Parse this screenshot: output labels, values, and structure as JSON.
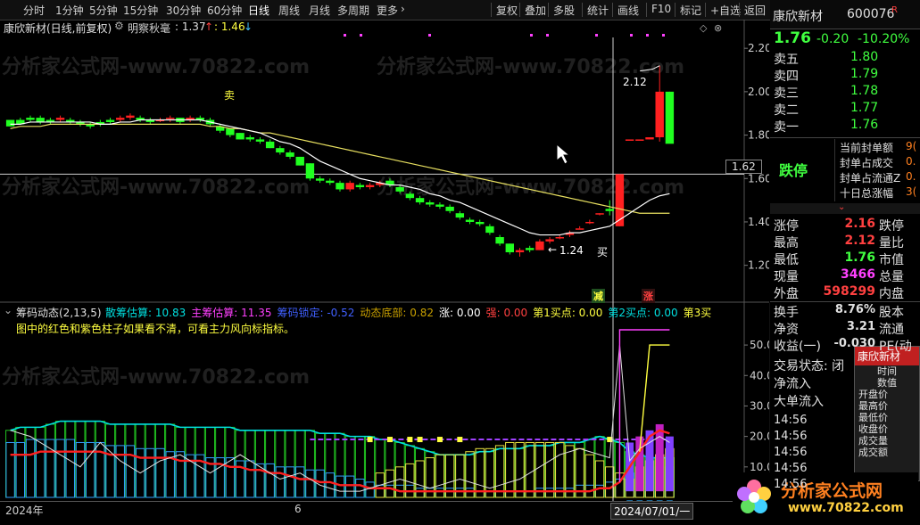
{
  "toolbar": {
    "periods": [
      "分时",
      "1分钟",
      "5分钟",
      "15分钟",
      "30分钟",
      "60分钟",
      "日线",
      "周线",
      "月线",
      "多周期",
      "更多"
    ],
    "active_period": "日线",
    "tools": [
      "复权",
      "叠加",
      "多股",
      "统计",
      "画线",
      "F10",
      "标记",
      "+自选",
      "返回"
    ]
  },
  "main_chart": {
    "title": "康欣新材(日线,前复权)",
    "indicator_name": "明察秋毫",
    "indicator_v1": ": 1.37",
    "indicator_v2": ": 1.46",
    "sell_label": "卖",
    "buy_label": "买",
    "high_annot": "2.12",
    "low_annot": "1.24",
    "cursor_price": "1.62",
    "y_ticks": [
      "2.20",
      "2.00",
      "1.80",
      "1.60",
      "1.40",
      "1.20"
    ],
    "badge_left": "减",
    "badge_right": "涨"
  },
  "chart_data": [
    {
      "type": "candlestick",
      "title": "康欣新材(日线,前复权)",
      "ylim": [
        1.1,
        2.25
      ],
      "ohlc": [
        [
          1.87,
          1.87,
          1.84,
          1.84
        ],
        [
          1.87,
          1.88,
          1.85,
          1.85
        ],
        [
          1.88,
          1.89,
          1.86,
          1.87
        ],
        [
          1.88,
          1.89,
          1.85,
          1.86
        ],
        [
          1.87,
          1.88,
          1.85,
          1.86
        ],
        [
          1.87,
          1.89,
          1.86,
          1.88
        ],
        [
          1.87,
          1.88,
          1.85,
          1.86
        ],
        [
          1.86,
          1.87,
          1.84,
          1.85
        ],
        [
          1.85,
          1.86,
          1.83,
          1.84
        ],
        [
          1.86,
          1.87,
          1.84,
          1.85
        ],
        [
          1.87,
          1.88,
          1.85,
          1.86
        ],
        [
          1.87,
          1.89,
          1.86,
          1.88
        ],
        [
          1.88,
          1.9,
          1.87,
          1.89
        ],
        [
          1.88,
          1.89,
          1.86,
          1.87
        ],
        [
          1.87,
          1.88,
          1.85,
          1.86
        ],
        [
          1.87,
          1.88,
          1.86,
          1.87
        ],
        [
          1.88,
          1.89,
          1.86,
          1.88
        ],
        [
          1.88,
          1.88,
          1.85,
          1.86
        ],
        [
          1.87,
          1.89,
          1.86,
          1.88
        ],
        [
          1.88,
          1.89,
          1.86,
          1.87
        ],
        [
          1.87,
          1.88,
          1.84,
          1.85
        ],
        [
          1.84,
          1.85,
          1.81,
          1.82
        ],
        [
          1.83,
          1.83,
          1.79,
          1.8
        ],
        [
          1.81,
          1.81,
          1.78,
          1.78
        ],
        [
          1.79,
          1.8,
          1.77,
          1.78
        ],
        [
          1.78,
          1.79,
          1.76,
          1.77
        ],
        [
          1.77,
          1.78,
          1.74,
          1.74
        ],
        [
          1.74,
          1.75,
          1.71,
          1.72
        ],
        [
          1.72,
          1.73,
          1.69,
          1.7
        ],
        [
          1.7,
          1.7,
          1.66,
          1.66
        ],
        [
          1.67,
          1.67,
          1.59,
          1.6
        ],
        [
          1.6,
          1.61,
          1.58,
          1.59
        ],
        [
          1.59,
          1.6,
          1.57,
          1.58
        ],
        [
          1.58,
          1.59,
          1.54,
          1.55
        ],
        [
          1.55,
          1.59,
          1.54,
          1.58
        ],
        [
          1.57,
          1.58,
          1.55,
          1.56
        ],
        [
          1.56,
          1.58,
          1.55,
          1.57
        ],
        [
          1.57,
          1.59,
          1.56,
          1.58
        ],
        [
          1.59,
          1.6,
          1.56,
          1.57
        ],
        [
          1.56,
          1.57,
          1.53,
          1.54
        ],
        [
          1.53,
          1.54,
          1.5,
          1.51
        ],
        [
          1.51,
          1.52,
          1.48,
          1.49
        ],
        [
          1.49,
          1.5,
          1.47,
          1.48
        ],
        [
          1.48,
          1.49,
          1.46,
          1.47
        ],
        [
          1.47,
          1.48,
          1.44,
          1.45
        ],
        [
          1.44,
          1.45,
          1.41,
          1.42
        ],
        [
          1.41,
          1.42,
          1.39,
          1.4
        ],
        [
          1.4,
          1.41,
          1.38,
          1.39
        ],
        [
          1.38,
          1.39,
          1.34,
          1.35
        ],
        [
          1.33,
          1.34,
          1.29,
          1.3
        ],
        [
          1.3,
          1.3,
          1.25,
          1.26
        ],
        [
          1.26,
          1.28,
          1.24,
          1.27
        ],
        [
          1.28,
          1.29,
          1.26,
          1.27
        ],
        [
          1.27,
          1.32,
          1.27,
          1.31
        ],
        [
          1.31,
          1.33,
          1.3,
          1.32
        ],
        [
          1.33,
          1.34,
          1.32,
          1.33
        ],
        [
          1.34,
          1.36,
          1.33,
          1.35
        ],
        [
          1.37,
          1.38,
          1.37,
          1.37
        ],
        [
          1.4,
          1.41,
          1.39,
          1.4
        ],
        [
          1.44,
          1.44,
          1.43,
          1.44
        ],
        [
          1.46,
          1.5,
          1.43,
          1.45
        ],
        [
          1.38,
          1.62,
          1.38,
          1.62
        ],
        [
          1.78,
          1.78,
          1.78,
          1.78
        ],
        [
          1.78,
          1.78,
          1.78,
          1.78
        ],
        [
          1.78,
          1.79,
          1.78,
          1.79
        ],
        [
          1.79,
          2.12,
          1.77,
          2.0
        ],
        [
          2.0,
          2.0,
          1.78,
          1.76
        ]
      ],
      "ma_short": [
        1.85,
        1.85,
        1.86,
        1.86,
        1.86,
        1.86,
        1.86,
        1.86,
        1.86,
        1.85,
        1.85,
        1.86,
        1.86,
        1.87,
        1.87,
        1.87,
        1.87,
        1.87,
        1.87,
        1.87,
        1.86,
        1.85,
        1.84,
        1.83,
        1.82,
        1.81,
        1.79,
        1.77,
        1.76,
        1.74,
        1.71,
        1.68,
        1.66,
        1.64,
        1.62,
        1.6,
        1.59,
        1.58,
        1.57,
        1.57,
        1.56,
        1.55,
        1.53,
        1.52,
        1.5,
        1.49,
        1.47,
        1.45,
        1.43,
        1.41,
        1.39,
        1.37,
        1.35,
        1.34,
        1.34,
        1.34,
        1.35,
        1.35,
        1.36,
        1.37,
        1.38,
        1.41,
        1.44,
        1.47,
        1.5,
        1.52,
        1.53
      ],
      "ma_long": [
        1.83,
        1.84,
        1.84,
        1.84,
        1.85,
        1.85,
        1.85,
        1.85,
        1.85,
        1.85,
        1.85,
        1.85,
        1.85,
        1.85,
        1.85,
        1.85,
        1.85,
        1.85,
        1.85,
        1.85,
        1.84,
        1.84,
        1.83,
        1.83,
        1.82,
        1.81,
        1.81,
        1.8,
        1.79,
        1.78,
        1.77,
        1.76,
        1.75,
        1.74,
        1.73,
        1.72,
        1.71,
        1.7,
        1.69,
        1.68,
        1.67,
        1.66,
        1.65,
        1.64,
        1.63,
        1.62,
        1.61,
        1.6,
        1.59,
        1.58,
        1.57,
        1.56,
        1.55,
        1.54,
        1.53,
        1.52,
        1.51,
        1.5,
        1.49,
        1.48,
        1.47,
        1.46,
        1.45,
        1.44,
        1.44,
        1.44,
        1.44
      ]
    },
    {
      "type": "bar",
      "title": "筹码动态(2,13,5)",
      "ylim": [
        0,
        55
      ],
      "x_tick_labels": [
        "2024年",
        "6",
        "2024/07/01/一"
      ],
      "y_ticks": [
        "50.00",
        "40.00",
        "30.00",
        "20.00",
        "10.00"
      ],
      "series": [
        {
          "name": "散筹估算",
          "current": 10.83
        },
        {
          "name": "主筹估算",
          "current": 11.35
        },
        {
          "name": "筹码锁定",
          "current": -0.52
        },
        {
          "name": "动态底部",
          "current": 0.82
        }
      ],
      "blue_bars": [
        18,
        18,
        19,
        19,
        19,
        19,
        19,
        18,
        18,
        18,
        17,
        17,
        17,
        16,
        16,
        16,
        15,
        15,
        14,
        14,
        13,
        13,
        13,
        12,
        12,
        11,
        11,
        10,
        10,
        10,
        9,
        9,
        8,
        7,
        7,
        6,
        5,
        4,
        4,
        4,
        4,
        3,
        3,
        3,
        3,
        3,
        3,
        2,
        2,
        2,
        2,
        2,
        2,
        3,
        3,
        3,
        3,
        4,
        4,
        4,
        5,
        6,
        8,
        9,
        10,
        10,
        10
      ],
      "green_bars": [
        22,
        23,
        23,
        23,
        24,
        25,
        25,
        25,
        25,
        25,
        24,
        24,
        24,
        24,
        24,
        24,
        24,
        23,
        23,
        23,
        23,
        23,
        23,
        22,
        22,
        22,
        22,
        22,
        22,
        22,
        22,
        21,
        21,
        21,
        20,
        20,
        20,
        19,
        19,
        18,
        17,
        16,
        15,
        14,
        14,
        14,
        14,
        15,
        15,
        16,
        16,
        16,
        17,
        17,
        17,
        18,
        18,
        18,
        19,
        20,
        19,
        18,
        15,
        14,
        13,
        13,
        13
      ],
      "yellow_bars": [
        0,
        0,
        0,
        0,
        0,
        0,
        0,
        0,
        0,
        0,
        0,
        0,
        0,
        0,
        0,
        0,
        0,
        0,
        0,
        0,
        0,
        0,
        0,
        0,
        0,
        0,
        0,
        0,
        0,
        0,
        0,
        0,
        0,
        0,
        0,
        0,
        0,
        8,
        9,
        10,
        11,
        12,
        13,
        14,
        14,
        14,
        15,
        16,
        16,
        17,
        18,
        18,
        18,
        18,
        18,
        18,
        17,
        16,
        14,
        12,
        10,
        8,
        6,
        10,
        12,
        14,
        16
      ],
      "red_line": [
        14,
        14,
        14,
        15,
        15,
        15,
        15,
        15,
        15,
        15,
        14,
        14,
        14,
        13,
        13,
        13,
        13,
        12,
        12,
        12,
        11,
        11,
        10,
        10,
        9,
        9,
        8,
        8,
        7,
        6,
        6,
        5,
        5,
        4,
        4,
        4,
        3,
        3,
        3,
        2,
        2,
        2,
        2,
        2,
        2,
        2,
        2,
        2,
        2,
        2,
        2,
        2,
        2,
        2,
        2,
        2,
        2,
        2,
        2,
        3,
        3,
        5,
        10,
        15,
        20,
        22,
        21
      ],
      "white_line": [
        22,
        21,
        20,
        18,
        16,
        14,
        12,
        10,
        14,
        18,
        15,
        12,
        10,
        8,
        10,
        12,
        13,
        14,
        12,
        10,
        8,
        10,
        12,
        14,
        12,
        10,
        8,
        6,
        7,
        8,
        6,
        4,
        3,
        2,
        2,
        2,
        3,
        4,
        5,
        6,
        5,
        4,
        3,
        4,
        5,
        6,
        5,
        4,
        3,
        4,
        5,
        6,
        8,
        10,
        12,
        14,
        15,
        16,
        15,
        14,
        13,
        50,
        12,
        16,
        18,
        20,
        18
      ],
      "purple_bars": [
        0,
        0,
        0,
        0,
        0,
        0,
        0,
        0,
        0,
        0,
        0,
        0,
        0,
        0,
        0,
        0,
        0,
        0,
        0,
        0,
        0,
        0,
        0,
        0,
        0,
        0,
        0,
        0,
        0,
        0,
        0,
        0,
        0,
        0,
        0,
        0,
        0,
        0,
        0,
        0,
        0,
        0,
        0,
        0,
        0,
        0,
        0,
        0,
        0,
        0,
        0,
        0,
        0,
        0,
        0,
        0,
        0,
        0,
        0,
        0,
        0,
        0,
        18,
        20,
        22,
        24,
        20
      ]
    }
  ],
  "sub_chart": {
    "title": "筹码动态(2,13,5)",
    "items": [
      {
        "label": "散筹估算",
        "value": ": 10.83",
        "color": "#00e0e0"
      },
      {
        "label": "主筹估算",
        "value": ": 11.35",
        "color": "#ff40ff"
      },
      {
        "label": "筹码锁定",
        "value": ": -0.52",
        "color": "#4060ff"
      },
      {
        "label": "动态底部",
        "value": ": 0.82",
        "color": "#c8a000"
      },
      {
        "label": "涨",
        "value": ": 0.00",
        "color": "#ffffff"
      },
      {
        "label": "强",
        "value": ": 0.00",
        "color": "#ff4040"
      },
      {
        "label": "第1买点",
        "value": ": 0.00",
        "color": "#ffff40"
      },
      {
        "label": "第2买点",
        "value": ": 0.00",
        "color": "#00e0e0"
      },
      {
        "label": "第3买",
        "value": "",
        "color": "#ffff40"
      }
    ],
    "note": "图中的红色和紫色柱子如果看不清，可看主力风向标指标。",
    "x_labels": [
      "2024年",
      "6",
      "2024/07/01/一"
    ]
  },
  "panel": {
    "name": "康欣新材",
    "code": "600076",
    "flag": "R",
    "price": "1.76",
    "change": "-0.20",
    "pct": "-10.20%",
    "asks": [
      {
        "label": "卖五",
        "price": "1.80"
      },
      {
        "label": "卖四",
        "price": "1.79"
      },
      {
        "label": "卖三",
        "price": "1.78"
      },
      {
        "label": "卖二",
        "price": "1.77"
      },
      {
        "label": "卖一",
        "price": "1.76"
      }
    ],
    "limit_text": "跌停",
    "seal_rows": [
      {
        "label": "当前封单额",
        "value": "9("
      },
      {
        "label": "封单占成交",
        "value": "0."
      },
      {
        "label": "封单占流通Z",
        "value": "0."
      },
      {
        "label": "十日总涨幅",
        "value": "3("
      }
    ],
    "stats": [
      {
        "label": "涨停",
        "value": "2.16",
        "right": "跌停",
        "color": "#ff4040"
      },
      {
        "label": "最高",
        "value": "2.12",
        "right": "量比",
        "color": "#ff4040"
      },
      {
        "label": "最低",
        "value": "1.76",
        "right": "市值",
        "color": "#40ff40"
      },
      {
        "label": "现量",
        "value": "3466",
        "right": "总量",
        "color": "#ff40ff"
      },
      {
        "label": "外盘",
        "value": "598299",
        "right": "内盘",
        "color": "#ff4040"
      }
    ],
    "stats2": [
      {
        "label": "换手",
        "value": "8.76%",
        "right": "股本"
      },
      {
        "label": "净资",
        "value": "3.21",
        "right": "流通"
      },
      {
        "label": "收益(一)",
        "value": "-0.030",
        "right": "PE(动"
      }
    ],
    "trade_status": "交易状态: 闭",
    "net_in": "净流入",
    "big_in": "大单流入",
    "times": [
      "14:56",
      "14:56",
      "14:56",
      "14:56",
      "14:56"
    ],
    "popup_title": "康欣新材",
    "popup_items": [
      "时间",
      "数值",
      "开盘价",
      "最高价",
      "最低价",
      "收盘价",
      "成交量",
      "成交额"
    ]
  },
  "watermark": "分析家公式网-www.70822.com",
  "logo": {
    "title": "分析家公式网",
    "url": "www.70822.com"
  }
}
